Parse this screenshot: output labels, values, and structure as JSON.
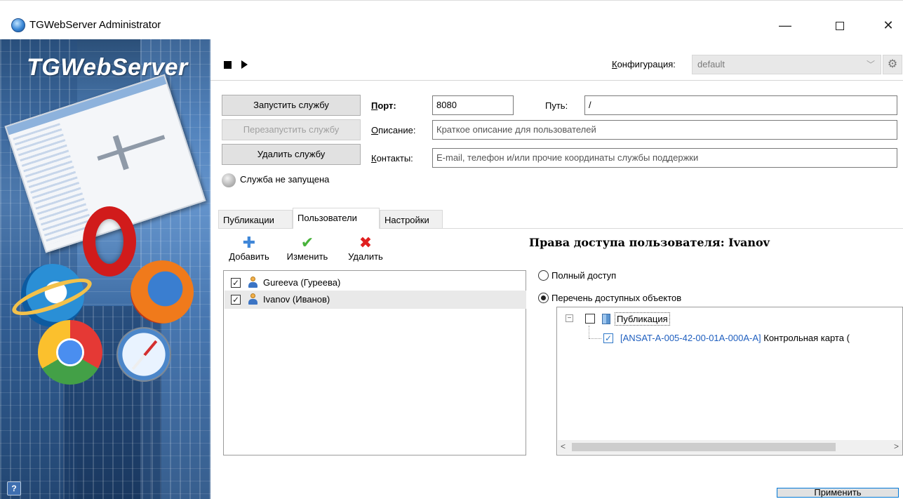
{
  "window": {
    "title": "TGWebServer Administrator",
    "minimize": "—",
    "close": "✕"
  },
  "banner": {
    "brand": "TGWebServer",
    "help": "?"
  },
  "toolbar": {
    "config_label_underlined": "К",
    "config_label_rest": "онфигурация:",
    "config_value": "default"
  },
  "service": {
    "start_button": "Запустить службу",
    "restart_button": "Перезапустить службу",
    "delete_button": "Удалить службу",
    "status_text": "Служба не запущена"
  },
  "form": {
    "port_label_underlined": "П",
    "port_label_rest": "орт:",
    "port_value": "8080",
    "path_label": "Путь:",
    "path_value": "/",
    "description_label_underlined": "О",
    "description_label_rest": "писание:",
    "description_placeholder": "Краткое описание для пользователей",
    "contacts_label_underlined": "К",
    "contacts_label_rest": "онтакты:",
    "contacts_placeholder": "E-mail, телефон и/или прочие координаты службы поддержки"
  },
  "tabs": [
    {
      "label": "Публикации",
      "active": false
    },
    {
      "label": "Пользователи",
      "active": true
    },
    {
      "label": "Настройки",
      "active": false
    }
  ],
  "users_toolbar": {
    "add": "Добавить",
    "edit": "Изменить",
    "delete": "Удалить"
  },
  "users": [
    {
      "name": "Gureeva (Гуреева)",
      "checked": true,
      "selected": false
    },
    {
      "name": "Ivanov (Иванов)",
      "checked": true,
      "selected": true
    }
  ],
  "rights": {
    "title": "Права доступа пользователя: Ivanov",
    "full_access": "Полный доступ",
    "object_list": "Перечень доступных объектов",
    "selected_mode": "object_list",
    "tree": {
      "root_label": "Публикация",
      "root_checked": false,
      "child_code": "[ANSAT-A-005-42-00-01A-000A-A]",
      "child_title": " Контрольная карта (",
      "child_checked": true
    },
    "scroll_left": "<",
    "scroll_right": ">"
  },
  "apply_button": "Применить",
  "colors": {
    "accent": "#0078d7",
    "link_code": "#1f5fbf",
    "disabled_text": "#a0a0a0",
    "cancel_red": "#e01f1f",
    "ok_green": "#48b33b",
    "add_blue": "#3f87d8"
  }
}
